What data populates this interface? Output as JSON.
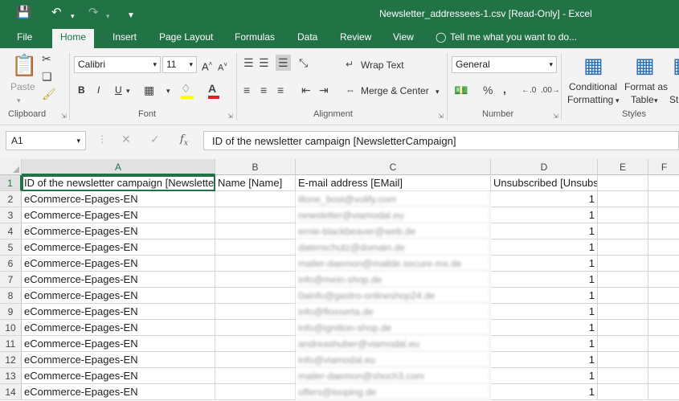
{
  "titlebar": {
    "title": "Newsletter_addressees-1.csv  [Read-Only] - Excel",
    "save_icon": "save-icon",
    "undo_icon": "undo-icon",
    "redo_icon": "redo-icon"
  },
  "tabs": [
    "File",
    "Home",
    "Insert",
    "Page Layout",
    "Formulas",
    "Data",
    "Review",
    "View",
    "Tell me what you want to do..."
  ],
  "ribbon": {
    "clipboard": {
      "paste": "Paste",
      "label": "Clipboard"
    },
    "font": {
      "name": "Calibri",
      "size": "11",
      "label": "Font",
      "bold": "B",
      "italic": "I",
      "underline": "U"
    },
    "alignment": {
      "wrap": "Wrap Text",
      "merge": "Merge & Center",
      "label": "Alignment"
    },
    "number": {
      "format": "General",
      "label": "Number"
    },
    "styles": {
      "conditional": "Conditional",
      "formatting": "Formatting",
      "format_as": "Format as",
      "table": "Table",
      "cell_styles_partial": "St",
      "label": "Styles"
    }
  },
  "formula_bar": {
    "cell_ref": "A1",
    "content": "ID of the newsletter campaign [NewsletterCampaign]"
  },
  "columns": [
    "A",
    "B",
    "C",
    "D",
    "E",
    "F"
  ],
  "rows": [
    {
      "n": "1",
      "a": "ID of the newsletter campaign [NewsletterCampaign]",
      "b": "Name [Name]",
      "c": "E-mail address [EMail]",
      "d": "Unsubscribed [Unsubscribed]"
    },
    {
      "n": "2",
      "a": "eCommerce-Epages-EN",
      "b": "",
      "c": "illone_bost@volify.com",
      "d": "1"
    },
    {
      "n": "3",
      "a": "eCommerce-Epages-EN",
      "b": "",
      "c": "newsletter@viamodal.eu",
      "d": "1"
    },
    {
      "n": "4",
      "a": "eCommerce-Epages-EN",
      "b": "",
      "c": "ernie-blackbeaver@web.de",
      "d": "1"
    },
    {
      "n": "5",
      "a": "eCommerce-Epages-EN",
      "b": "",
      "c": "datenschutz@domain.de",
      "d": "1"
    },
    {
      "n": "6",
      "a": "eCommerce-Epages-EN",
      "b": "",
      "c": "mailer-daemon@mailde.secure-mx.de",
      "d": "1"
    },
    {
      "n": "7",
      "a": "eCommerce-Epages-EN",
      "b": "",
      "c": "info@mein-shop.de",
      "d": "1"
    },
    {
      "n": "8",
      "a": "eCommerce-Epages-EN",
      "b": "",
      "c": "0ainfo@gastro-onlineshop24.de",
      "d": "1"
    },
    {
      "n": "9",
      "a": "eCommerce-Epages-EN",
      "b": "",
      "c": "info@flosserta.de",
      "d": "1"
    },
    {
      "n": "10",
      "a": "eCommerce-Epages-EN",
      "b": "",
      "c": "info@ignition-shop.de",
      "d": "1"
    },
    {
      "n": "11",
      "a": "eCommerce-Epages-EN",
      "b": "",
      "c": "andreashuber@viamodal.eu",
      "d": "1"
    },
    {
      "n": "12",
      "a": "eCommerce-Epages-EN",
      "b": "",
      "c": "info@viamodal.eu",
      "d": "1"
    },
    {
      "n": "13",
      "a": "eCommerce-Epages-EN",
      "b": "",
      "c": "mailer-daemon@shoch3.com",
      "d": "1"
    },
    {
      "n": "14",
      "a": "eCommerce-Epages-EN",
      "b": "",
      "c": "offers@looping.de",
      "d": "1"
    }
  ]
}
